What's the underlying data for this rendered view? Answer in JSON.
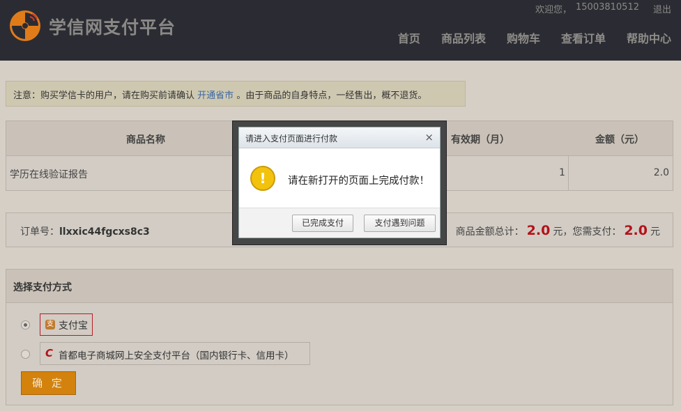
{
  "header": {
    "brand": "学信网支付平台",
    "welcome": "欢迎您，",
    "user": "15003810512",
    "logout": "退出",
    "nav": [
      "首页",
      "商品列表",
      "购物车",
      "查看订单",
      "帮助中心"
    ]
  },
  "notice": {
    "prefix": "注意：购买学信卡的用户，请在购买前请确认",
    "link": "开通省市",
    "suffix": "。由于商品的自身特点，一经售出，概不退货。"
  },
  "product_table": {
    "headers": {
      "name": "商品名称",
      "validity": "有效期（月）",
      "amount": "金额（元）"
    },
    "row": {
      "name": "学历在线验证报告",
      "validity": "1",
      "amount": "2.0"
    }
  },
  "order": {
    "label": "订单号：",
    "number": "llxxic44fgcxs8c3",
    "total_label": "商品金额总计：",
    "total": "2.0",
    "unit": "元",
    "pay_label": "，您需支付：",
    "pay": "2.0"
  },
  "payment": {
    "title": "选择支付方式",
    "options": [
      "支付宝",
      "首都电子商城网上安全支付平台（国内银行卡、信用卡）"
    ],
    "confirm": "确 定"
  },
  "dialog": {
    "title": "请进入支付页面进行付款",
    "close": "×",
    "message": "请在新打开的页面上完成付款！",
    "btn_done": "已完成支付",
    "btn_problem": "支付遇到问题"
  }
}
